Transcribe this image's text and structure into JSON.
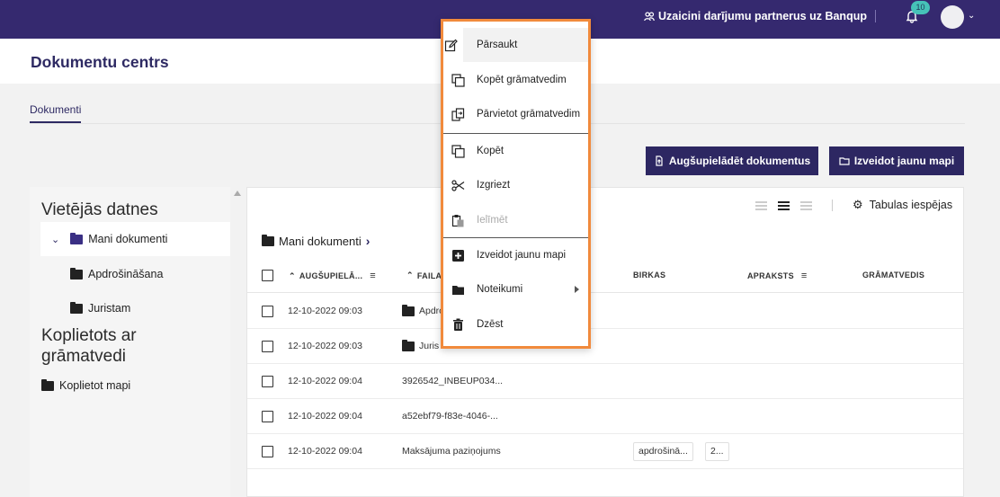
{
  "topbar": {
    "invite_label": "Uzaicini darījumu partnerus uz Banqup",
    "notification_count": "10",
    "colors": {
      "bg": "#35296f",
      "badge": "#46c2b8"
    }
  },
  "header": {
    "title": "Dokumentu centrs"
  },
  "tabs": [
    {
      "label": "Dokumenti",
      "active": true
    }
  ],
  "actions": {
    "upload_label": "Augšupielādēt dokumentus",
    "new_folder_label": "Izveidot jaunu mapi"
  },
  "sidebar": {
    "local_heading": "Vietējās datnes",
    "folders": [
      {
        "label": "Mani dokumenti",
        "expanded": true,
        "selected": true
      },
      {
        "label": "Apdrošināšana"
      },
      {
        "label": "Juristam"
      }
    ],
    "shared_heading": "Koplietots ar grāmatvedi",
    "shared_folder": "Koplietot mapi"
  },
  "table": {
    "options_label": "Tabulas iespējas",
    "breadcrumb": "Mani dokumenti",
    "columns": {
      "uploaded": "AUGŠUPIELĀ...",
      "file": "FAILA",
      "tags": "BIRKAS",
      "description": "APRAKSTS",
      "accountant": "GRĀMATVEDIS"
    },
    "rows": [
      {
        "date": "12-10-2022 09:03",
        "name": "Apdro",
        "folder": true
      },
      {
        "date": "12-10-2022 09:03",
        "name": "Juris",
        "folder": true
      },
      {
        "date": "12-10-2022 09:04",
        "name": "3926542_INBEUP034..."
      },
      {
        "date": "12-10-2022 09:04",
        "name": "a52ebf79-f83e-4046-..."
      },
      {
        "date": "12-10-2022 09:04",
        "name": "Maksājuma paziņojums",
        "tags": [
          "apdrošinā...",
          "2..."
        ]
      }
    ]
  },
  "context_menu": {
    "border_color": "#f18a3c",
    "items": {
      "rename": "Pārsaukt",
      "copy_to_accountant": "Kopēt grāmatvedim",
      "move_to_accountant": "Pārvietot grāmatvedim",
      "copy": "Kopēt",
      "cut": "Izgriezt",
      "paste": "Ielīmēt",
      "new_folder": "Izveidot jaunu mapi",
      "rules": "Noteikumi",
      "delete": "Dzēst"
    }
  }
}
